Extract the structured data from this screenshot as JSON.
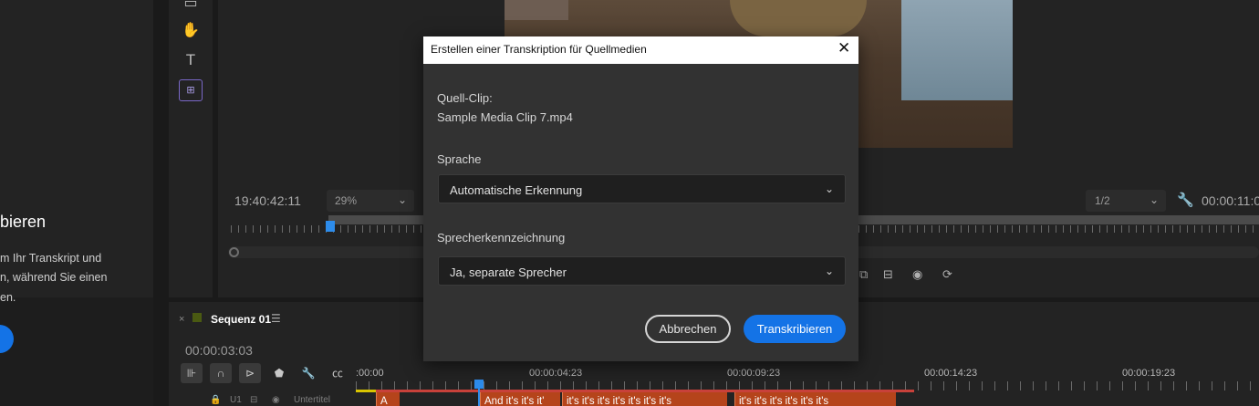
{
  "left_panel": {
    "heading": "bieren",
    "lines": [
      "m Ihr Transkript und",
      "n, während Sie einen",
      "en."
    ]
  },
  "monitor": {
    "timecode": "19:40:42:11",
    "zoom": "29%",
    "resolution": "1/2",
    "timecode_right": "00:00:11:0"
  },
  "timeline": {
    "sequence_title": "Sequenz 01",
    "timecode": "00:00:03:03",
    "ruler_times": [
      ":00:00",
      "00:00:04:23",
      "00:00:09:23",
      "00:00:14:23",
      "00:00:19:23"
    ],
    "track_label": "Untertitel",
    "track_id": "U1",
    "clips": [
      "A",
      "And it's it's it'",
      "it's it's it's it's it's it's it's",
      "it's it's it's it's it's it's"
    ]
  },
  "dialog": {
    "title": "Erstellen einer Transkription für Quellmedien",
    "source_label": "Quell-Clip:",
    "source_value": "Sample Media Clip 7.mp4",
    "language_label": "Sprache",
    "language_value": "Automatische Erkennung",
    "speaker_label": "Sprecherkennzeichnung",
    "speaker_value": "Ja, separate Sprecher",
    "cancel_label": "Abbrechen",
    "ok_label": "Transkribieren"
  },
  "colors": {
    "accent": "#1473e6",
    "clip": "#b5441b",
    "playhead": "#2d8ceb"
  }
}
